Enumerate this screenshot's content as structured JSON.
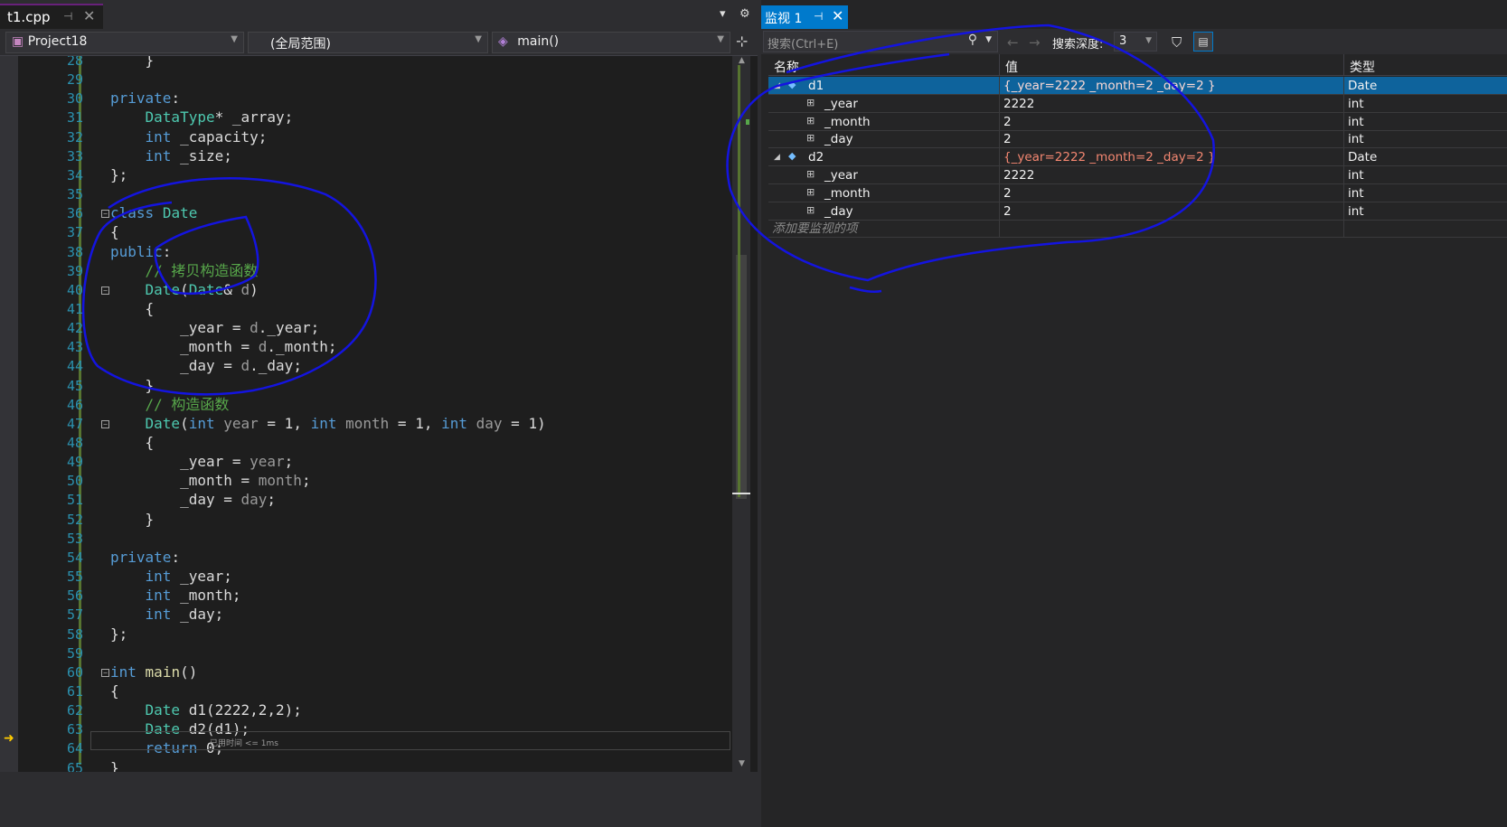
{
  "editor": {
    "tab_title": "t1.cpp",
    "project": "Project18",
    "scope": "(全局范围)",
    "member": "main()",
    "time_hint": "已用时间 <= 1ms"
  },
  "lines": [
    {
      "num": "28",
      "html": "    }"
    },
    {
      "num": "29",
      "html": ""
    },
    {
      "num": "30",
      "html": "<span class=\"k\">private</span>:"
    },
    {
      "num": "31",
      "html": "    <span class=\"t\">DataType</span>* <span class=\"m\">_array</span>;"
    },
    {
      "num": "32",
      "html": "    <span class=\"k\">int</span> <span class=\"m\">_capacity</span>;"
    },
    {
      "num": "33",
      "html": "    <span class=\"k\">int</span> <span class=\"m\">_size</span>;"
    },
    {
      "num": "34",
      "html": "};"
    },
    {
      "num": "35",
      "html": ""
    },
    {
      "num": "36",
      "html": "<span class=\"k\">class</span> <span class=\"t\">Date</span>"
    },
    {
      "num": "37",
      "html": "{"
    },
    {
      "num": "38",
      "html": "<span class=\"k\">public</span>:"
    },
    {
      "num": "39",
      "html": "    <span class=\"c\">// 拷贝构造函数</span>"
    },
    {
      "num": "40",
      "html": "    <span class=\"t\">Date</span>(<span class=\"t\">Date</span>&amp; <span class=\"p\">d</span>)"
    },
    {
      "num": "41",
      "html": "    {"
    },
    {
      "num": "42",
      "html": "        <span class=\"m\">_year</span> = <span class=\"p\">d</span>.<span class=\"m\">_year</span>;"
    },
    {
      "num": "43",
      "html": "        <span class=\"m\">_month</span> = <span class=\"p\">d</span>.<span class=\"m\">_month</span>;"
    },
    {
      "num": "44",
      "html": "        <span class=\"m\">_day</span> = <span class=\"p\">d</span>.<span class=\"m\">_day</span>;"
    },
    {
      "num": "45",
      "html": "    }"
    },
    {
      "num": "46",
      "html": "    <span class=\"c\">// 构造函数</span>"
    },
    {
      "num": "47",
      "html": "    <span class=\"t\">Date</span>(<span class=\"k\">int</span> <span class=\"p\">year</span> = 1, <span class=\"k\">int</span> <span class=\"p\">month</span> = 1, <span class=\"k\">int</span> <span class=\"p\">day</span> = 1)"
    },
    {
      "num": "48",
      "html": "    {"
    },
    {
      "num": "49",
      "html": "        <span class=\"m\">_year</span> = <span class=\"p\">year</span>;"
    },
    {
      "num": "50",
      "html": "        <span class=\"m\">_month</span> = <span class=\"p\">month</span>;"
    },
    {
      "num": "51",
      "html": "        <span class=\"m\">_day</span> = <span class=\"p\">day</span>;"
    },
    {
      "num": "52",
      "html": "    }"
    },
    {
      "num": "53",
      "html": ""
    },
    {
      "num": "54",
      "html": "<span class=\"k\">private</span>:"
    },
    {
      "num": "55",
      "html": "    <span class=\"k\">int</span> <span class=\"m\">_year</span>;"
    },
    {
      "num": "56",
      "html": "    <span class=\"k\">int</span> <span class=\"m\">_month</span>;"
    },
    {
      "num": "57",
      "html": "    <span class=\"k\">int</span> <span class=\"m\">_day</span>;"
    },
    {
      "num": "58",
      "html": "};"
    },
    {
      "num": "59",
      "html": ""
    },
    {
      "num": "60",
      "html": "<span class=\"k\">int</span> <span class=\"f\">main</span>()"
    },
    {
      "num": "61",
      "html": "{"
    },
    {
      "num": "62",
      "html": "    <span class=\"t\">Date</span> d1(2222,2,2);"
    },
    {
      "num": "63",
      "html": "    <span class=\"t\">Date</span> d2(d1);"
    },
    {
      "num": "64",
      "html": "    <span class=\"k\">return</span> 0;"
    },
    {
      "num": "65",
      "html": "}"
    }
  ],
  "watch": {
    "tab_title": "监视 1",
    "search_placeholder": "搜索(Ctrl+E)",
    "depth_label": "搜索深度:",
    "depth_value": "3",
    "col_name": "名称",
    "col_value": "值",
    "col_type": "类型",
    "add_item": "添加要监视的项",
    "rows": [
      {
        "name": "d1",
        "value": "{_year=2222 _month=2 _day=2 }",
        "type": "Date",
        "level": 0,
        "changed": true,
        "selected": true
      },
      {
        "name": "_year",
        "value": "2222",
        "type": "int",
        "level": 1,
        "changed": false,
        "selected": false
      },
      {
        "name": "_month",
        "value": "2",
        "type": "int",
        "level": 1,
        "changed": false,
        "selected": false
      },
      {
        "name": "_day",
        "value": "2",
        "type": "int",
        "level": 1,
        "changed": false,
        "selected": false
      },
      {
        "name": "d2",
        "value": "{_year=2222 _month=2 _day=2 }",
        "type": "Date",
        "level": 0,
        "changed": true,
        "selected": false
      },
      {
        "name": "_year",
        "value": "2222",
        "type": "int",
        "level": 1,
        "changed": false,
        "selected": false
      },
      {
        "name": "_month",
        "value": "2",
        "type": "int",
        "level": 1,
        "changed": false,
        "selected": false
      },
      {
        "name": "_day",
        "value": "2",
        "type": "int",
        "level": 1,
        "changed": false,
        "selected": false
      }
    ]
  },
  "colors": {
    "accent": "#007acc",
    "annotation": "#1010ee"
  }
}
